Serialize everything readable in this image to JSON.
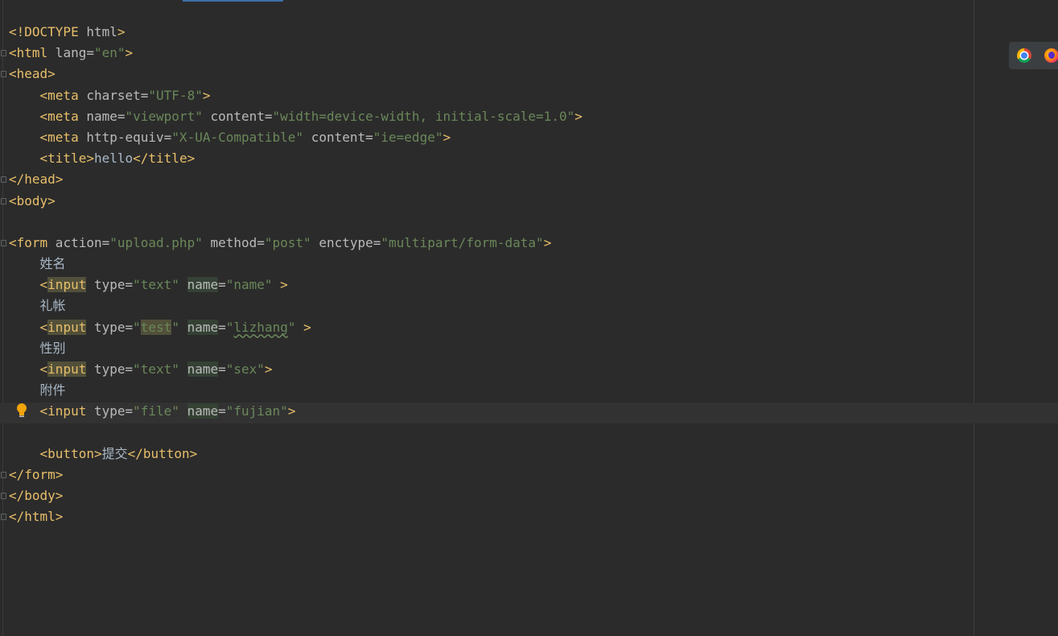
{
  "editor": {
    "lines": {
      "l1": {
        "doctype": "<!DOCTYPE",
        "html_kw": " html",
        "close": ">"
      },
      "l2": {
        "open": "<html",
        "attr": " lang=",
        "val": "\"en\"",
        "close": ">"
      },
      "l3": {
        "tag": "<head>"
      },
      "l4": {
        "indent": "    ",
        "open": "<meta",
        "attr": " charset=",
        "val": "\"UTF-8\"",
        "close": ">"
      },
      "l5": {
        "indent": "    ",
        "open": "<meta",
        "attr1": " name=",
        "val1": "\"viewport\"",
        "attr2": " content=",
        "val2": "\"width=device-width, initial-scale=1.0\"",
        "close": ">"
      },
      "l6": {
        "indent": "    ",
        "open": "<meta",
        "attr1": " http-equiv=",
        "val1": "\"X-UA-Compatible\"",
        "attr2": " content=",
        "val2": "\"ie=edge\"",
        "close": ">"
      },
      "l7": {
        "indent": "    ",
        "open": "<title>",
        "text": "hello",
        "close": "</title>"
      },
      "l8": {
        "tag": "</head>"
      },
      "l9": {
        "tag": "<body>"
      },
      "l11": {
        "open": "<form",
        "attr1": " action=",
        "val1": "\"upload.php\"",
        "attr2": " method=",
        "val2": "\"post\"",
        "attr3": " enctype=",
        "val3": "\"multipart/form-data\"",
        "close": ">"
      },
      "l12": {
        "indent": "    ",
        "text": "姓名"
      },
      "l13": {
        "indent": "    ",
        "lt": "<",
        "kw": "input",
        "attr1": " type=",
        "val1": "\"text\"",
        "sp": " ",
        "attr2": "name",
        "eq": "=",
        "val2": "\"name\"",
        "close": " >"
      },
      "l14": {
        "indent": "    ",
        "text": "礼帐"
      },
      "l15": {
        "indent": "    ",
        "lt": "<",
        "kw": "input",
        "attr1": " type=",
        "q1": "\"",
        "val1": "test",
        "q2": "\"",
        "sp": " ",
        "attr2": "name",
        "eq": "=",
        "q3": "\"",
        "val2": "lizhang",
        "q4": "\"",
        "close": " >"
      },
      "l16": {
        "indent": "    ",
        "text": "性别"
      },
      "l17": {
        "indent": "    ",
        "lt": "<",
        "kw": "input",
        "attr1": " type=",
        "val1": "\"text\"",
        "sp": " ",
        "attr2": "name",
        "eq": "=",
        "val2": "\"sex\"",
        "close": ">"
      },
      "l18": {
        "indent": "    ",
        "text": "附件"
      },
      "l19": {
        "indent": "    ",
        "open": "<input",
        "attr1": " type=",
        "val1": "\"file\"",
        "sp": " ",
        "attr2": "name",
        "eq": "=",
        "val2": "\"fujian\"",
        "close": ">"
      },
      "l21": {
        "indent": "    ",
        "open": "<button>",
        "text": "提交",
        "close": "</button>"
      },
      "l22": {
        "tag": "</form>"
      },
      "l23": {
        "tag": "</body>"
      },
      "l24": {
        "tag": "</html>"
      }
    }
  },
  "browser_panel": {
    "icons": [
      "chrome-icon",
      "firefox-icon"
    ]
  },
  "colors": {
    "background": "#2b2b2b",
    "tag": "#e8bf6a",
    "string": "#6a8759",
    "attribute": "#bababa",
    "text": "#a9b7c6"
  }
}
